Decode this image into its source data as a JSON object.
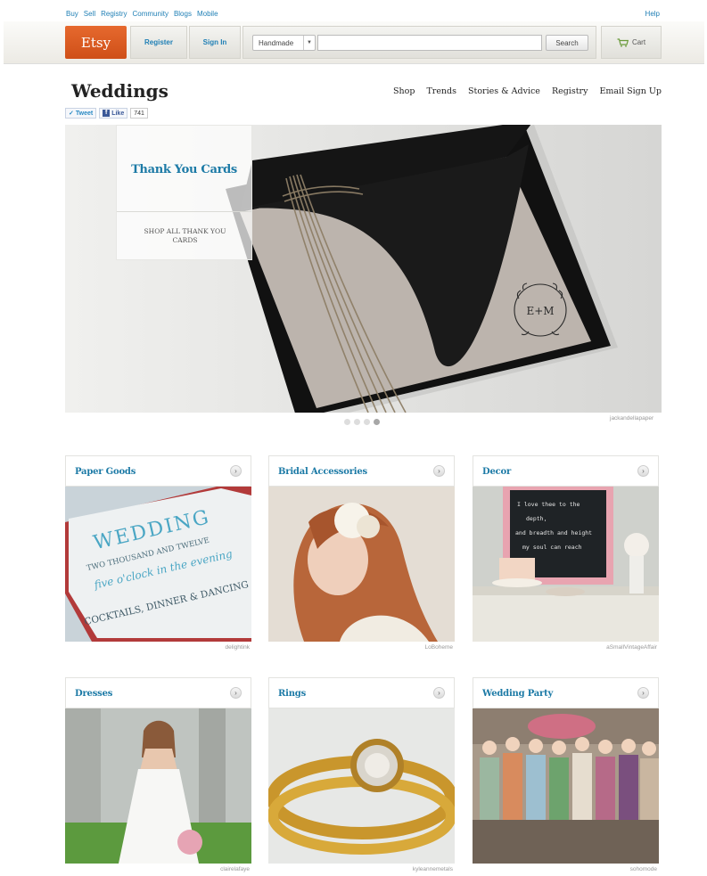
{
  "top_links": [
    "Buy",
    "Sell",
    "Registry",
    "Community",
    "Blogs",
    "Mobile"
  ],
  "help": "Help",
  "header": {
    "logo": "Etsy",
    "register": "Register",
    "sign_in": "Sign In",
    "search_scope": "Handmade",
    "search_value": "",
    "search_button": "Search",
    "cart": "Cart"
  },
  "page_title": "Weddings",
  "nav": [
    "Shop",
    "Trends",
    "Stories & Advice",
    "Registry",
    "Email Sign Up"
  ],
  "social": {
    "tweet": "Tweet",
    "like": "Like",
    "like_count": "741"
  },
  "hero": {
    "title": "Thank You Cards",
    "link": "SHOP ALL THANK YOU CARDS",
    "credit": "jackandellapaper",
    "monogram": "E+M",
    "slides": 4,
    "active_slide": 4
  },
  "cards": [
    {
      "title": "Paper Goods",
      "credit": "delightink"
    },
    {
      "title": "Bridal Accessories",
      "credit": "LoBoheme"
    },
    {
      "title": "Decor",
      "credit": "aSmallVintageAffair"
    },
    {
      "title": "Dresses",
      "credit": "clairelafaye"
    },
    {
      "title": "Rings",
      "credit": "kyleannemetals"
    },
    {
      "title": "Wedding Party",
      "credit": "sohomode"
    }
  ],
  "paper_goods_text": {
    "line1": "WEDDING",
    "line2": "TWO THOUSAND AND TWELVE",
    "line3": "five o'clock in the evening",
    "line4": "COCKTAILS, DINNER & DANCING"
  },
  "decor_chalkboard": [
    "I love thee to the",
    "depth,",
    "and breadth and height",
    "my soul can reach"
  ],
  "icons": {
    "cart": "cart-icon",
    "arrow": "chevron-right-icon",
    "caret": "caret-down-icon"
  }
}
